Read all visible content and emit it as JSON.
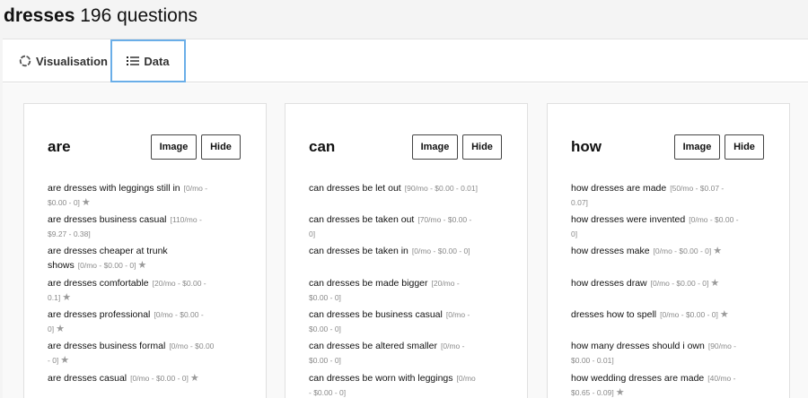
{
  "header": {
    "keyword": "dresses",
    "count": "196 questions"
  },
  "tabs": [
    {
      "label": "Visualisation",
      "icon": "circle-icon"
    },
    {
      "label": "Data",
      "icon": "list-icon"
    }
  ],
  "card_buttons": {
    "image": "Image",
    "hide": "Hide"
  },
  "star_glyph": "★",
  "cards": [
    {
      "title": "are",
      "questions": [
        {
          "text": "are dresses with leggings still in",
          "meta": "[0/mo - $0.00 - 0]"
        },
        {
          "text": "are dresses business casual",
          "meta": "[110/mo - $9.27 - 0.38]"
        },
        {
          "text": "are dresses cheaper at trunk shows",
          "meta": "[0/mo - $0.00 - 0]"
        },
        {
          "text": "are dresses comfortable",
          "meta": "[20/mo - $0.00 - 0.1]"
        },
        {
          "text": "are dresses professional",
          "meta": "[0/mo - $0.00 - 0]"
        },
        {
          "text": "are dresses business formal",
          "meta": "[0/mo - $0.00 - 0]"
        },
        {
          "text": "are dresses casual",
          "meta": "[0/mo - $0.00 - 0]"
        }
      ]
    },
    {
      "title": "can",
      "questions": [
        {
          "text": "can dresses be let out",
          "meta": "[90/mo - $0.00 - 0.01]"
        },
        {
          "text": "can dresses be taken out",
          "meta": "[70/mo - $0.00 - 0]"
        },
        {
          "text": "can dresses be taken in",
          "meta": "[0/mo - $0.00 - 0]"
        },
        {
          "text": "can dresses be made bigger",
          "meta": "[20/mo - $0.00 - 0]"
        },
        {
          "text": "can dresses be business casual",
          "meta": "[0/mo - $0.00 - 0]"
        },
        {
          "text": "can dresses be altered smaller",
          "meta": "[0/mo - $0.00 - 0]"
        },
        {
          "text": "can dresses be worn with leggings",
          "meta": "[0/mo - $0.00 - 0]"
        }
      ]
    },
    {
      "title": "how",
      "questions": [
        {
          "text": "how dresses are made",
          "meta": "[50/mo - $0.07 - 0.07]"
        },
        {
          "text": "how dresses were invented",
          "meta": "[0/mo - $0.00 - 0]"
        },
        {
          "text": "how dresses make",
          "meta": "[0/mo - $0.00 - 0]"
        },
        {
          "text": "how dresses draw",
          "meta": "[0/mo - $0.00 - 0]"
        },
        {
          "text": "dresses how to spell",
          "meta": "[0/mo - $0.00 - 0]"
        },
        {
          "text": "how many dresses should i own",
          "meta": "[90/mo - $0.00 - 0.01]"
        },
        {
          "text": "how wedding dresses are made",
          "meta": "[40/mo - $0.65 - 0.09]"
        }
      ]
    }
  ]
}
